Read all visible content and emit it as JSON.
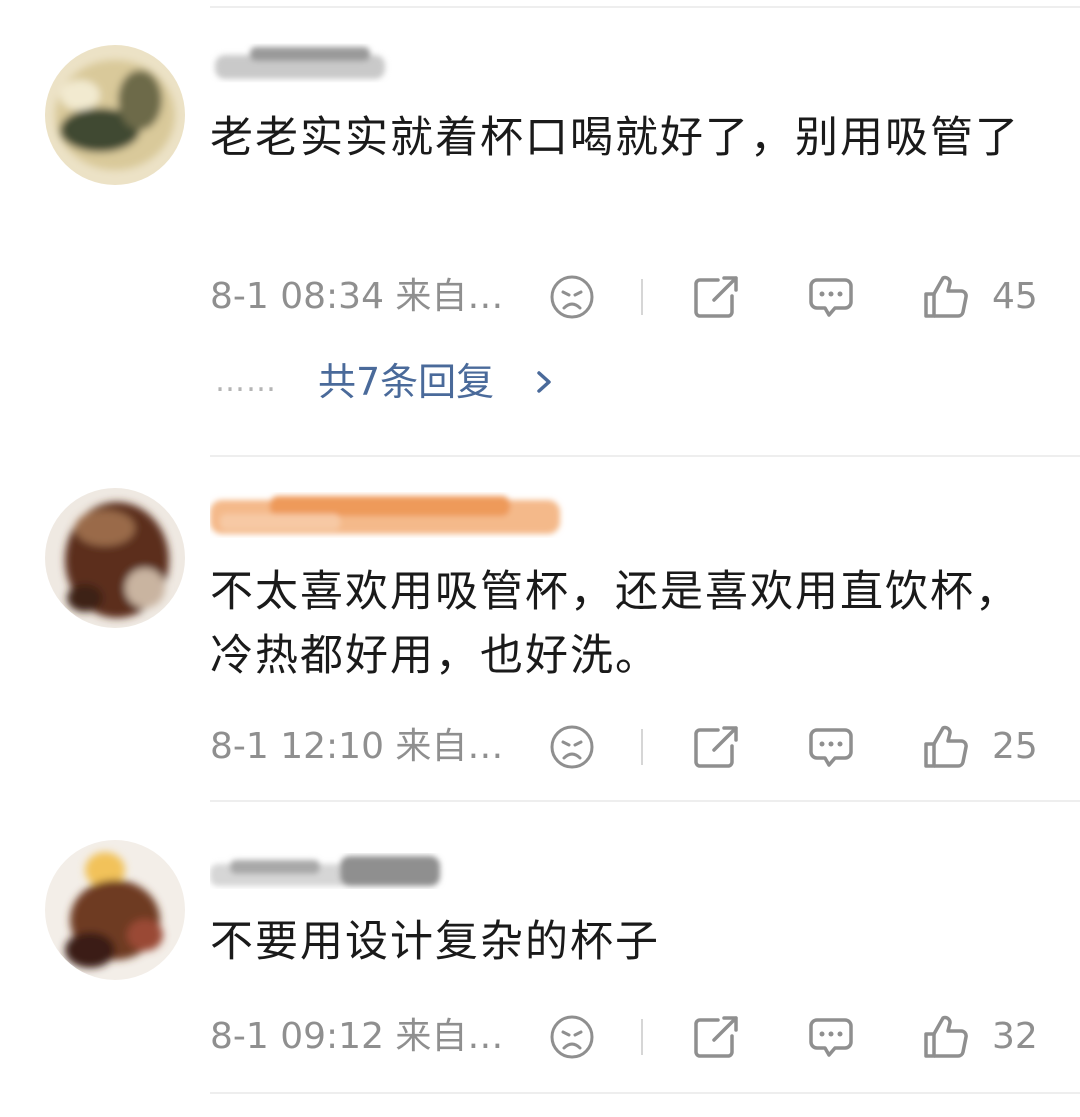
{
  "comments": [
    {
      "text": "老老实实就着杯口喝就好了，别用吸管了",
      "time_source": "8-1 08:34 来自…",
      "likes": "45",
      "replies_dots": "……",
      "replies_label": "共7条回复"
    },
    {
      "text": "不太喜欢用吸管杯，还是喜欢用直饮杯，冷热都好用，也好洗。",
      "time_source": "8-1 12:10 来自…",
      "likes": "25"
    },
    {
      "text": "不要用设计复杂的杯子",
      "time_source": "8-1 09:12 来自…",
      "likes": "32"
    }
  ],
  "icons": {
    "sad": "sad-face-icon",
    "share": "share-icon",
    "comment": "comment-icon",
    "like": "thumbs-up-icon",
    "chevron": "chevron-right-icon"
  },
  "colors": {
    "meta_text": "#8f8f8f",
    "link": "#4a6a9a",
    "divider": "#eeeeee"
  }
}
